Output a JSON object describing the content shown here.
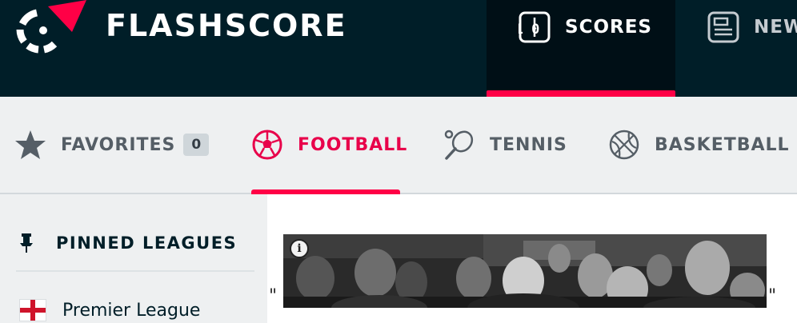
{
  "header": {
    "logo_text": "FLASHSCORE",
    "nav": [
      {
        "label": "SCORES",
        "icon": "scoreboard-icon",
        "icon_text": "1 0",
        "active": true
      },
      {
        "label": "NEW",
        "icon": "news-icon",
        "active": false
      }
    ]
  },
  "sports": [
    {
      "label": "FAVORITES",
      "icon": "star-icon",
      "badge": "0",
      "active": false
    },
    {
      "label": "FOOTBALL",
      "icon": "soccer-ball-icon",
      "active": true
    },
    {
      "label": "TENNIS",
      "icon": "tennis-racket-icon",
      "active": false
    },
    {
      "label": "BASKETBALL",
      "icon": "basketball-icon",
      "active": false
    }
  ],
  "sidebar": {
    "pinned_title": "PINNED LEAGUES",
    "pinned_icon": "pin-icon",
    "leagues": [
      {
        "label": "Premier League",
        "flag": "england-flag-icon"
      }
    ]
  },
  "ad": {
    "quote_open": "\"",
    "quote_close": "\"",
    "info_symbol": "i",
    "info_icon": "info-icon"
  },
  "colors": {
    "header_bg": "#001e28",
    "accent": "#ff0046",
    "active_text": "#e8004a",
    "inactive_text": "#555e66"
  }
}
